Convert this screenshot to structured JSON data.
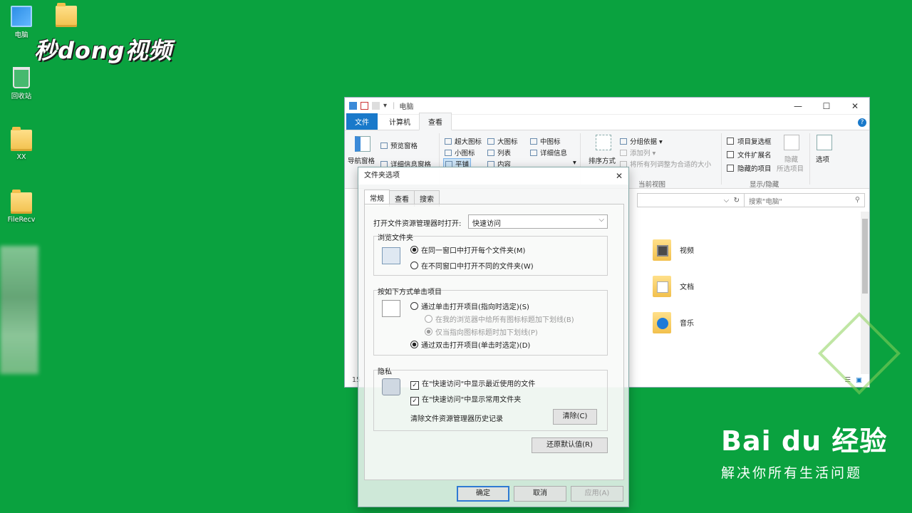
{
  "desktop": {
    "icons": [
      {
        "label": "电脑",
        "icon": "computer-icon"
      },
      {
        "label": "回收站",
        "icon": "recycle-bin-icon"
      },
      {
        "label": "XX",
        "icon": "folder-icon"
      },
      {
        "label": "FileRecv",
        "icon": "folder-icon"
      }
    ],
    "logo": "秒dong视频"
  },
  "explorer": {
    "title": "电脑",
    "tabs": [
      "文件",
      "计算机",
      "查看"
    ],
    "active_tab": "查看",
    "ribbon": {
      "pane": {
        "nav": "导航窗格",
        "preview": "预览窗格",
        "details": "详细信息窗格"
      },
      "layout": [
        "超大图标",
        "大图标",
        "中图标",
        "小图标",
        "列表",
        "详细信息",
        "平铺",
        "内容"
      ],
      "sort": "排序方式",
      "group_by": "分组依据",
      "add_column": "添加列",
      "fit_columns": "将所有列调整为合适的大小",
      "current_view_label": "当前视图",
      "checkboxes": [
        "项目复选框",
        "文件扩展名",
        "隐藏的项目"
      ],
      "hide_selected": [
        "隐藏",
        "所选项目"
      ],
      "show_hide_label": "显示/隐藏",
      "options": "选项"
    },
    "search_placeholder": "搜索\"电脑\"",
    "folders": [
      "视频",
      "文档",
      "音乐"
    ],
    "status_count": "15"
  },
  "dialog": {
    "title": "文件夹选项",
    "tabs": [
      "常规",
      "查看",
      "搜索"
    ],
    "open_label": "打开文件资源管理器时打开:",
    "open_value": "快速访问",
    "browse_group": "浏览文件夹",
    "browse_same": "在同一窗口中打开每个文件夹(M)",
    "browse_new": "在不同窗口中打开不同的文件夹(W)",
    "click_group": "按如下方式单击项目",
    "single_click": "通过单击打开项目(指向时选定)(S)",
    "underline_all": "在我的浏览器中给所有图标标题加下划线(B)",
    "underline_point": "仅当指向图标标题时加下划线(P)",
    "double_click": "通过双击打开项目(单击时选定)(D)",
    "privacy_group": "隐私",
    "show_recent": "在\"快速访问\"中显示最近使用的文件",
    "show_frequent": "在\"快速访问\"中显示常用文件夹",
    "clear_history_label": "清除文件资源管理器历史记录",
    "clear_button": "清除(C)",
    "restore_button": "还原默认值(R)",
    "ok": "确定",
    "cancel": "取消",
    "apply": "应用(A)"
  },
  "watermark": {
    "brand": "Bai du 经验",
    "slogan": "解决你所有生活问题"
  },
  "colors": {
    "desktop": "#0aa23f",
    "accent": "#1979ca"
  }
}
